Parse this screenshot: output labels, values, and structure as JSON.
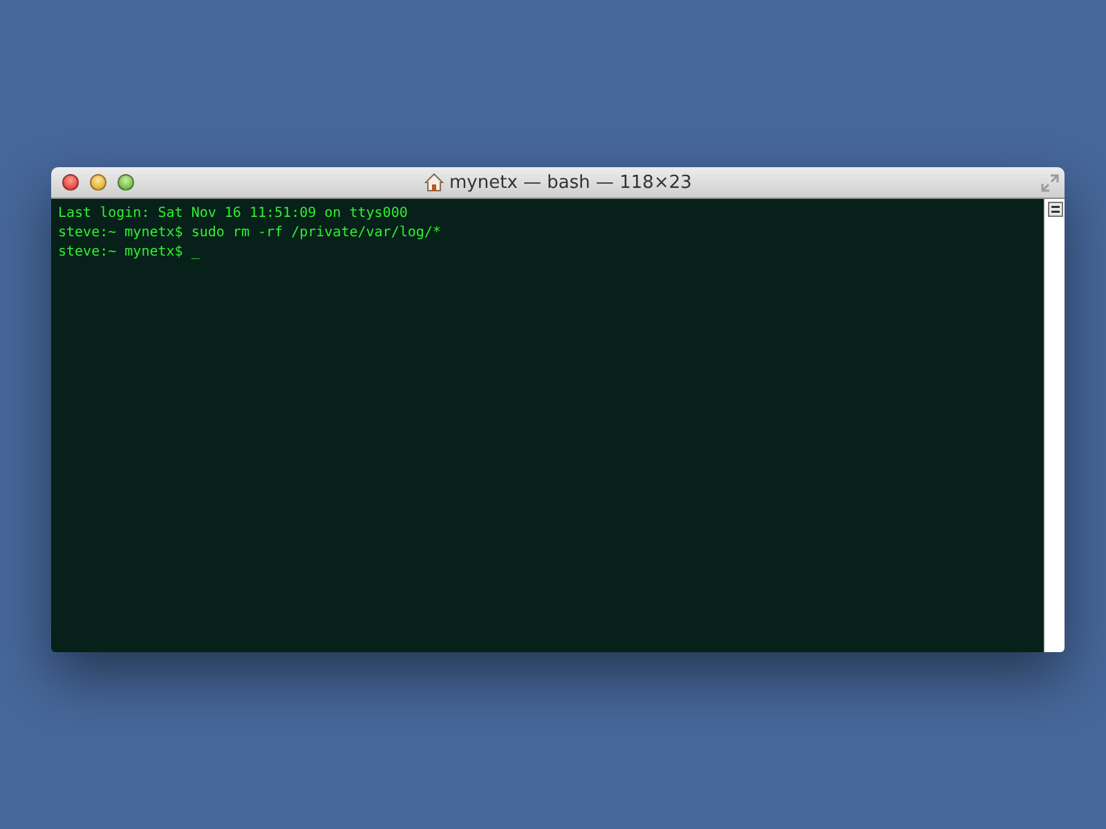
{
  "window": {
    "title": "mynetx — bash — 118×23"
  },
  "terminal": {
    "lines": [
      "Last login: Sat Nov 16 11:51:09 on ttys000",
      "steve:~ mynetx$ sudo rm -rf /private/var/log/*",
      "steve:~ mynetx$ _"
    ]
  }
}
